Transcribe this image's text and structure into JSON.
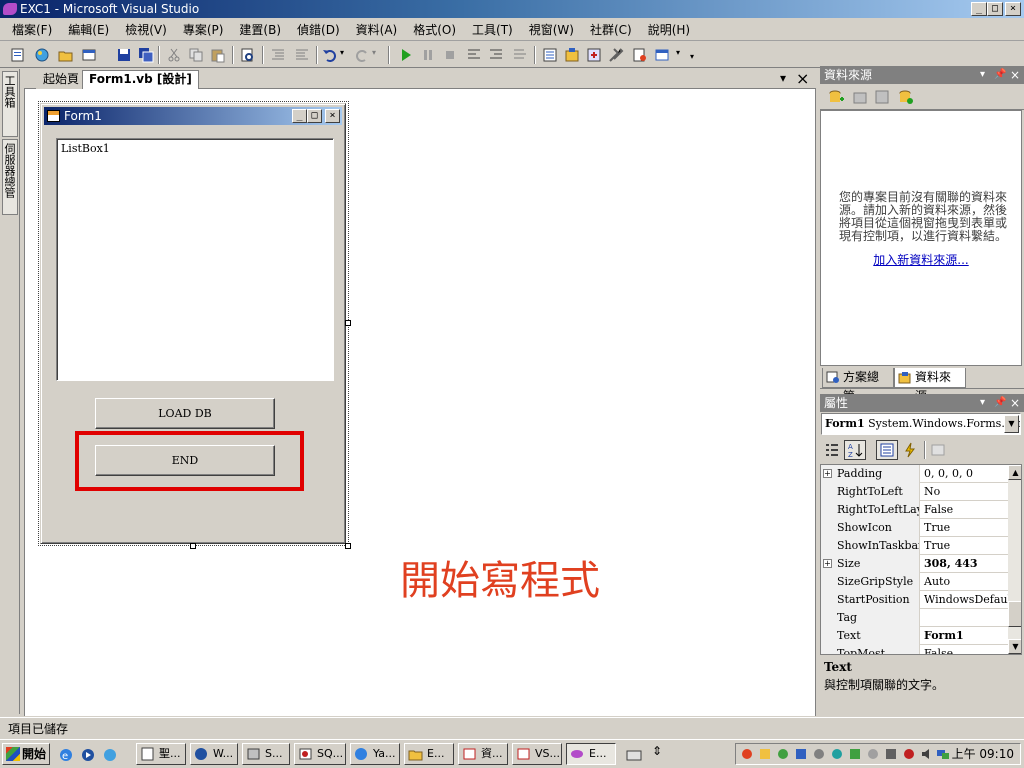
{
  "window": {
    "title": "EXC1 - Microsoft Visual Studio",
    "buttons": {
      "minimize": "_",
      "maximize": "□",
      "close": "×"
    }
  },
  "menu": [
    "檔案(F)",
    "編輯(E)",
    "檢視(V)",
    "專案(P)",
    "建置(B)",
    "偵錯(D)",
    "資料(A)",
    "格式(O)",
    "工具(T)",
    "視窗(W)",
    "社群(C)",
    "說明(H)"
  ],
  "left_strip": {
    "toolbox": "工具箱",
    "server_explorer": "伺服器總管"
  },
  "doc_tabs": [
    {
      "label": "起始頁",
      "active": false
    },
    {
      "label": "Form1.vb [設計]",
      "active": true
    }
  ],
  "doc_controls": {
    "dropdown": "▾",
    "close": "×"
  },
  "form": {
    "title": "Form1",
    "listbox_text": "ListBox1",
    "load_button": "LOAD DB",
    "end_button": "END"
  },
  "overlay_caption": "開始寫程式",
  "datasource_panel": {
    "title": "資料來源",
    "message": "您的專案目前沒有關聯的資料來源。請加入新的資料來源，然後將項目從這個視窗拖曳到表單或現有控制項，以進行資料繫結。",
    "link": "加入新資料來源..."
  },
  "panel_tabs": [
    {
      "label": "方案總管"
    },
    {
      "label": "資料來源"
    }
  ],
  "properties_panel": {
    "title": "屬性",
    "object_name": "Form1",
    "object_type": "System.Windows.Forms.Form",
    "rows": [
      {
        "name": "Padding",
        "value": "0, 0, 0, 0",
        "expandable": true,
        "bold": false
      },
      {
        "name": "RightToLeft",
        "value": "No",
        "expandable": false,
        "bold": false
      },
      {
        "name": "RightToLeftLayout",
        "value": "False",
        "expandable": false,
        "bold": false
      },
      {
        "name": "ShowIcon",
        "value": "True",
        "expandable": false,
        "bold": false
      },
      {
        "name": "ShowInTaskbar",
        "value": "True",
        "expandable": false,
        "bold": false
      },
      {
        "name": "Size",
        "value": "308, 443",
        "expandable": true,
        "bold": true
      },
      {
        "name": "SizeGripStyle",
        "value": "Auto",
        "expandable": false,
        "bold": false
      },
      {
        "name": "StartPosition",
        "value": "WindowsDefaultLocation",
        "expandable": false,
        "bold": false
      },
      {
        "name": "Tag",
        "value": "",
        "expandable": false,
        "bold": false
      },
      {
        "name": "Text",
        "value": "Form1",
        "expandable": false,
        "bold": true
      },
      {
        "name": "TopMost",
        "value": "False",
        "expandable": false,
        "bold": false
      }
    ],
    "description_title": "Text",
    "description_text": "與控制項關聯的文字。"
  },
  "status": {
    "text": "項目已儲存"
  },
  "taskbar": {
    "start": "開始",
    "buttons": [
      "聖...",
      "W...",
      "S...",
      "SQ...",
      "Ya...",
      "E...",
      "資...",
      "VS...",
      "E..."
    ],
    "active_index": 8,
    "clock": "上午 09:10"
  },
  "colors": {
    "title_gradient_start": "#0a246a",
    "highlight": "#e00000",
    "overlay": "#e04020",
    "link": "#0000c0"
  }
}
